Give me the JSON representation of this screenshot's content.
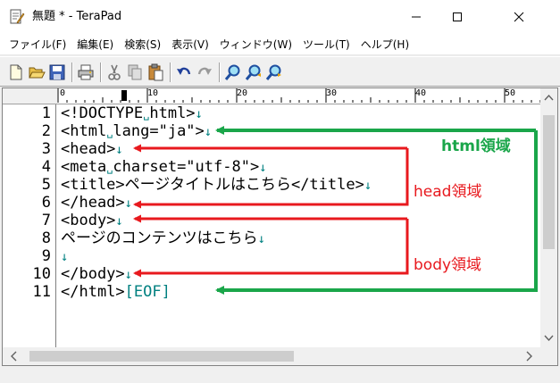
{
  "window": {
    "title": "無題 * - TeraPad",
    "controls": [
      "minimize",
      "maximize",
      "close"
    ]
  },
  "menu": [
    "ファイル(F)",
    "編集(E)",
    "検索(S)",
    "表示(V)",
    "ウィンドウ(W)",
    "ツール(T)",
    "ヘルプ(H)"
  ],
  "toolbar": [
    "new-file-icon",
    "open-folder-icon",
    "save-icon",
    "print-icon",
    "cut-icon",
    "copy-icon",
    "paste-icon",
    "undo-icon",
    "redo-icon",
    "find-icon",
    "find-prev-icon",
    "find-next-icon"
  ],
  "ruler": {
    "labels": [
      "0",
      "10",
      "20",
      "30",
      "40",
      "50"
    ]
  },
  "editor": {
    "line_numbers": [
      "1",
      "2",
      "3",
      "4",
      "5",
      "6",
      "7",
      "8",
      "9",
      "10",
      "11"
    ],
    "lines": [
      {
        "parts": [
          {
            "t": "<!DOCTYPE"
          },
          {
            "t": "␣",
            "k": "sp"
          },
          {
            "t": "html>"
          },
          {
            "t": "↓",
            "k": "nl"
          }
        ]
      },
      {
        "parts": [
          {
            "t": "<html"
          },
          {
            "t": "␣",
            "k": "sp"
          },
          {
            "t": "lang=\"ja\">"
          },
          {
            "t": "↓",
            "k": "nl"
          }
        ]
      },
      {
        "parts": [
          {
            "t": "<head>"
          },
          {
            "t": "↓",
            "k": "nl"
          }
        ]
      },
      {
        "parts": [
          {
            "t": "<meta"
          },
          {
            "t": "␣",
            "k": "sp"
          },
          {
            "t": "charset=\"utf-8\">"
          },
          {
            "t": "↓",
            "k": "nl"
          }
        ]
      },
      {
        "parts": [
          {
            "t": "<title>ページタイトルはこちら</title>"
          },
          {
            "t": "↓",
            "k": "nl"
          }
        ]
      },
      {
        "parts": [
          {
            "t": "</head>"
          },
          {
            "t": "↓",
            "k": "nl"
          }
        ]
      },
      {
        "parts": [
          {
            "t": "<body>"
          },
          {
            "t": "↓",
            "k": "nl"
          }
        ]
      },
      {
        "parts": [
          {
            "t": "ページのコンテンツはこちら"
          },
          {
            "t": "↓",
            "k": "nl"
          }
        ]
      },
      {
        "parts": [
          {
            "t": "↓",
            "k": "nl"
          }
        ]
      },
      {
        "parts": [
          {
            "t": "</body>"
          },
          {
            "t": "↓",
            "k": "nl"
          }
        ]
      },
      {
        "parts": [
          {
            "t": "</html>"
          },
          {
            "t": "[EOF]",
            "k": "eof"
          }
        ]
      }
    ]
  },
  "annotations": {
    "html": {
      "label": "html領域",
      "color": "#1aa64a"
    },
    "head": {
      "label": "head領域",
      "color": "#e8191e"
    },
    "body": {
      "label": "body領域",
      "color": "#e8191e"
    }
  }
}
